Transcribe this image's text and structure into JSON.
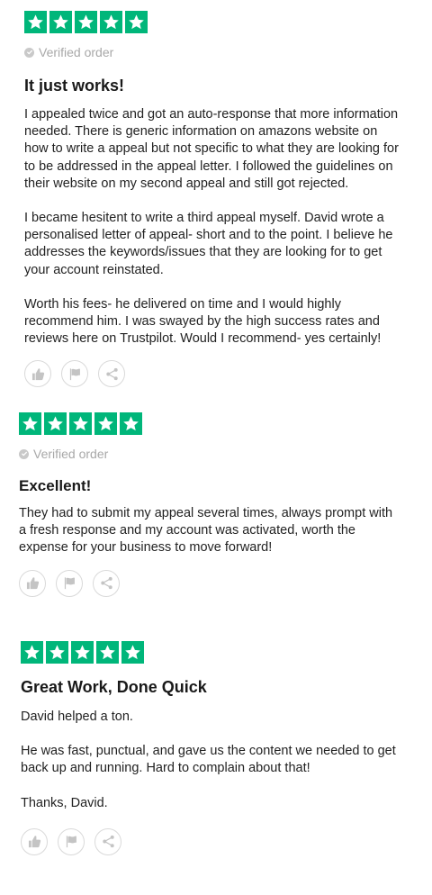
{
  "colors": {
    "star_green": "#00b67a",
    "muted": "#a8a8a8"
  },
  "reviews": [
    {
      "rating": 5,
      "verified": "Verified order",
      "title": "It just works!",
      "paragraphs": [
        "I appealed twice and got an auto-response that more information needed. There is generic information on amazons website on how to write a appeal but not specific to what they are looking for to be addressed in the appeal letter. I followed the guidelines on their website on my second appeal and still got rejected.",
        "I became hesitent to write a third appeal myself. David wrote a personalised letter of appeal- short and to the point. I believe he addresses the keywords/issues that they are looking for to get your account reinstated.",
        "Worth his fees- he delivered on time and I would highly recommend him. I was swayed by the high success rates and reviews here on Trustpilot. Would I recommend- yes certainly!"
      ]
    },
    {
      "rating": 5,
      "verified": "Verified order",
      "title": "Excellent!",
      "paragraphs": [
        "They had to submit my appeal several times, always prompt with a fresh response and my account was activated, worth the expense for your business to move forward!"
      ]
    },
    {
      "rating": 5,
      "verified": null,
      "title": "Great Work, Done Quick",
      "paragraphs": [
        "David helped a ton.",
        "He was fast, punctual, and gave us the content we needed to get back up and running. Hard to complain about that!",
        "Thanks, David."
      ]
    }
  ],
  "icons": {
    "useful": "thumbs-up-icon",
    "report": "flag-icon",
    "share": "share-icon"
  }
}
